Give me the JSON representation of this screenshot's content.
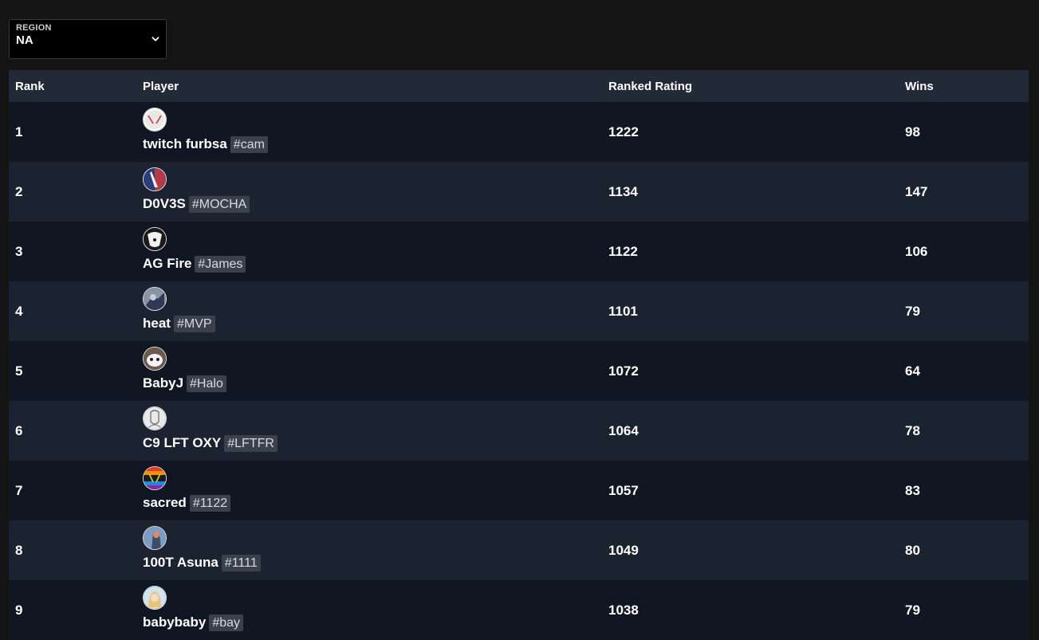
{
  "region": {
    "label": "REGION",
    "value": "NA"
  },
  "table": {
    "headers": {
      "rank": "Rank",
      "player": "Player",
      "rating": "Ranked Rating",
      "wins": "Wins"
    },
    "rows": [
      {
        "rank": "1",
        "name": "twitch furbsa",
        "tag": "#cam",
        "rating": "1222",
        "wins": "98",
        "avatar": "valorant-logo-avatar-icon"
      },
      {
        "rank": "2",
        "name": "D0V3S",
        "tag": "#MOCHA",
        "rating": "1134",
        "wins": "147",
        "avatar": "agent-avatar-icon"
      },
      {
        "rank": "3",
        "name": "AG Fire",
        "tag": "#James",
        "rating": "1122",
        "wins": "106",
        "avatar": "white-mask-avatar-icon"
      },
      {
        "rank": "4",
        "name": "heat",
        "tag": "#MVP",
        "rating": "1101",
        "wins": "79",
        "avatar": "agent-avatar-icon"
      },
      {
        "rank": "5",
        "name": "BabyJ",
        "tag": "#Halo",
        "rating": "1072",
        "wins": "64",
        "avatar": "pet-avatar-icon"
      },
      {
        "rank": "6",
        "name": "C9 LFT OXY",
        "tag": "#LFTFR",
        "rating": "1064",
        "wins": "78",
        "avatar": "sketch-avatar-icon"
      },
      {
        "rank": "7",
        "name": "sacred",
        "tag": "#1122",
        "rating": "1057",
        "wins": "83",
        "avatar": "rainbow-valorant-avatar-icon"
      },
      {
        "rank": "8",
        "name": "100T Asuna",
        "tag": "#1111",
        "rating": "1049",
        "wins": "80",
        "avatar": "agent-avatar-icon"
      },
      {
        "rank": "9",
        "name": "babybaby",
        "tag": "#bay",
        "rating": "1038",
        "wins": "79",
        "avatar": "anime-avatar-icon"
      }
    ]
  },
  "colors": {
    "page_bg": "#141414",
    "header_bg": "#232a37",
    "row_odd": "#111722",
    "row_even": "#1b2230",
    "tag_bg": "#3a414d"
  }
}
